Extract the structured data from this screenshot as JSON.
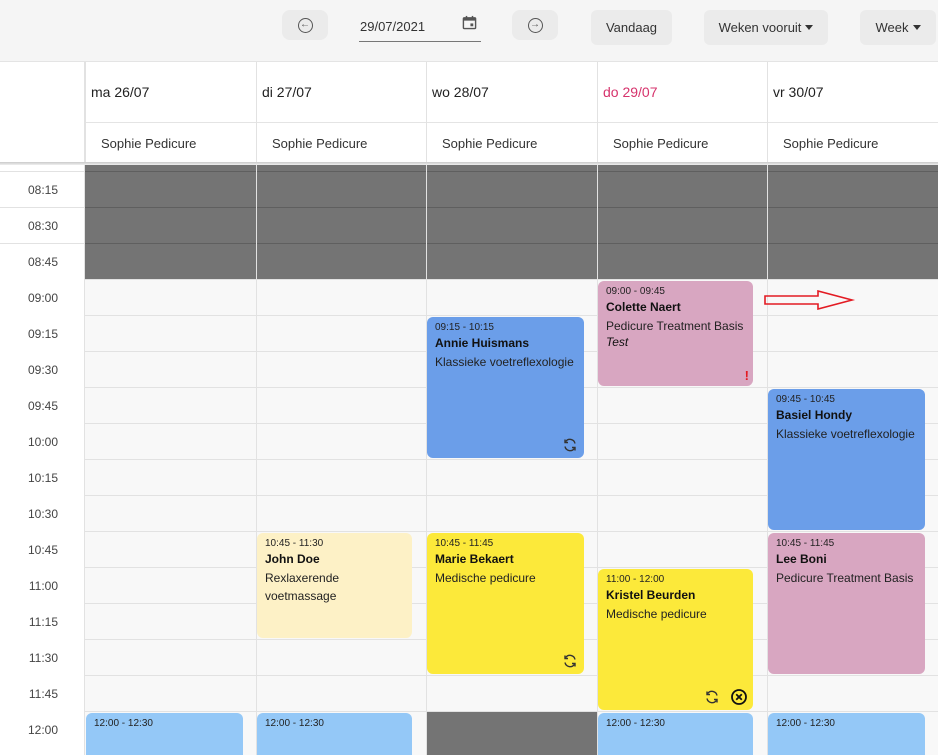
{
  "toolbar": {
    "prev_icon": "arrow-left-circle-icon",
    "next_icon": "arrow-right-circle-icon",
    "date_value": "29/07/2021",
    "calendar_icon": "calendar-icon",
    "today_label": "Vandaag",
    "weeks_ahead_label": "Weken vooruit",
    "view_label": "Week"
  },
  "days": [
    {
      "label": "ma 26/07",
      "resource": "Sophie Pedicure",
      "today": false
    },
    {
      "label": "di 27/07",
      "resource": "Sophie Pedicure",
      "today": false
    },
    {
      "label": "wo 28/07",
      "resource": "Sophie Pedicure",
      "today": false
    },
    {
      "label": "do 29/07",
      "resource": "Sophie Pedicure",
      "today": true
    },
    {
      "label": "vr 30/07",
      "resource": "Sophie Pedicure",
      "today": false
    }
  ],
  "times": [
    "08:15",
    "08:30",
    "08:45",
    "09:00",
    "09:15",
    "09:30",
    "09:45",
    "10:00",
    "10:15",
    "10:30",
    "10:45",
    "11:00",
    "11:15",
    "11:30",
    "11:45",
    "12:00"
  ],
  "colors": {
    "today": "#d6336c",
    "closed": "#747474",
    "blue": "#6b9ee9",
    "pink": "#d8a6c1",
    "cream": "#fdf1c6",
    "yellow": "#fce93a",
    "light_blue": "#94c8f7",
    "annotation_arrow": "#e31b23"
  },
  "events": [
    {
      "id": "colette",
      "time": "09:00 - 09:45",
      "client": "Colette Naert",
      "service": "Pedicure Treatment Basis",
      "note": "Test",
      "warning": "!"
    },
    {
      "id": "annie",
      "time": "09:15 - 10:15",
      "client": "Annie Huismans",
      "service": "Klassieke voetreflexologie",
      "icons": [
        "repeat-icon"
      ]
    },
    {
      "id": "basiel",
      "time": "09:45 - 10:45",
      "client": "Basiel Hondy",
      "service": "Klassieke voetreflexologie"
    },
    {
      "id": "john",
      "time": "10:45 - 11:30",
      "client": "John Doe",
      "service": "Rexlaxerende voetmassage"
    },
    {
      "id": "marie",
      "time": "10:45 - 11:45",
      "client": "Marie Bekaert",
      "service": "Medische pedicure",
      "icons": [
        "repeat-icon"
      ]
    },
    {
      "id": "lee",
      "time": "10:45 - 11:45",
      "client": "Lee Boni",
      "service": "Pedicure Treatment Basis"
    },
    {
      "id": "kristel",
      "time": "11:00 - 12:00",
      "client": "Kristel Beurden",
      "service": "Medische pedicure",
      "icons": [
        "repeat-icon",
        "cancel-circle-icon"
      ]
    },
    {
      "id": "mon1200",
      "time": "12:00 - 12:30"
    },
    {
      "id": "tue1200",
      "time": "12:00 - 12:30"
    },
    {
      "id": "thu1200",
      "time": "12:00 - 12:30"
    },
    {
      "id": "fri1200",
      "time": "12:00 - 12:30"
    }
  ]
}
